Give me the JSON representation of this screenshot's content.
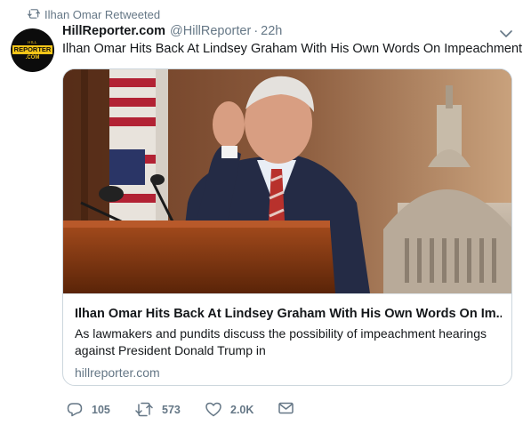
{
  "retweet_context": {
    "text": "Ilhan Omar Retweeted"
  },
  "author": {
    "avatar": {
      "line1": "HILL",
      "line2": "REPORTER",
      "line3": ".COM"
    },
    "name": "HillReporter.com",
    "handle": "@HillReporter",
    "separator": "·",
    "time": "22h"
  },
  "tweet": {
    "text": "Ilhan Omar Hits Back At Lindsey Graham With His Own Words On Impeachment"
  },
  "card": {
    "title": "Ilhan Omar Hits Back At Lindsey Graham With His Own Words On Im...",
    "description": "As lawmakers and pundits discuss the possibility of impeachment hearings against President Donald Trump in",
    "domain": "hillreporter.com"
  },
  "actions": {
    "reply_count": "105",
    "retweet_count": "573",
    "like_count": "2.0K"
  },
  "colors": {
    "text": "#14171a",
    "secondary": "#657786",
    "border": "#ccd6dd",
    "brand_yellow": "#f5c518"
  },
  "icons": [
    "retweet-icon",
    "caret-down-icon",
    "reply-icon",
    "like-icon",
    "direct-message-icon"
  ]
}
